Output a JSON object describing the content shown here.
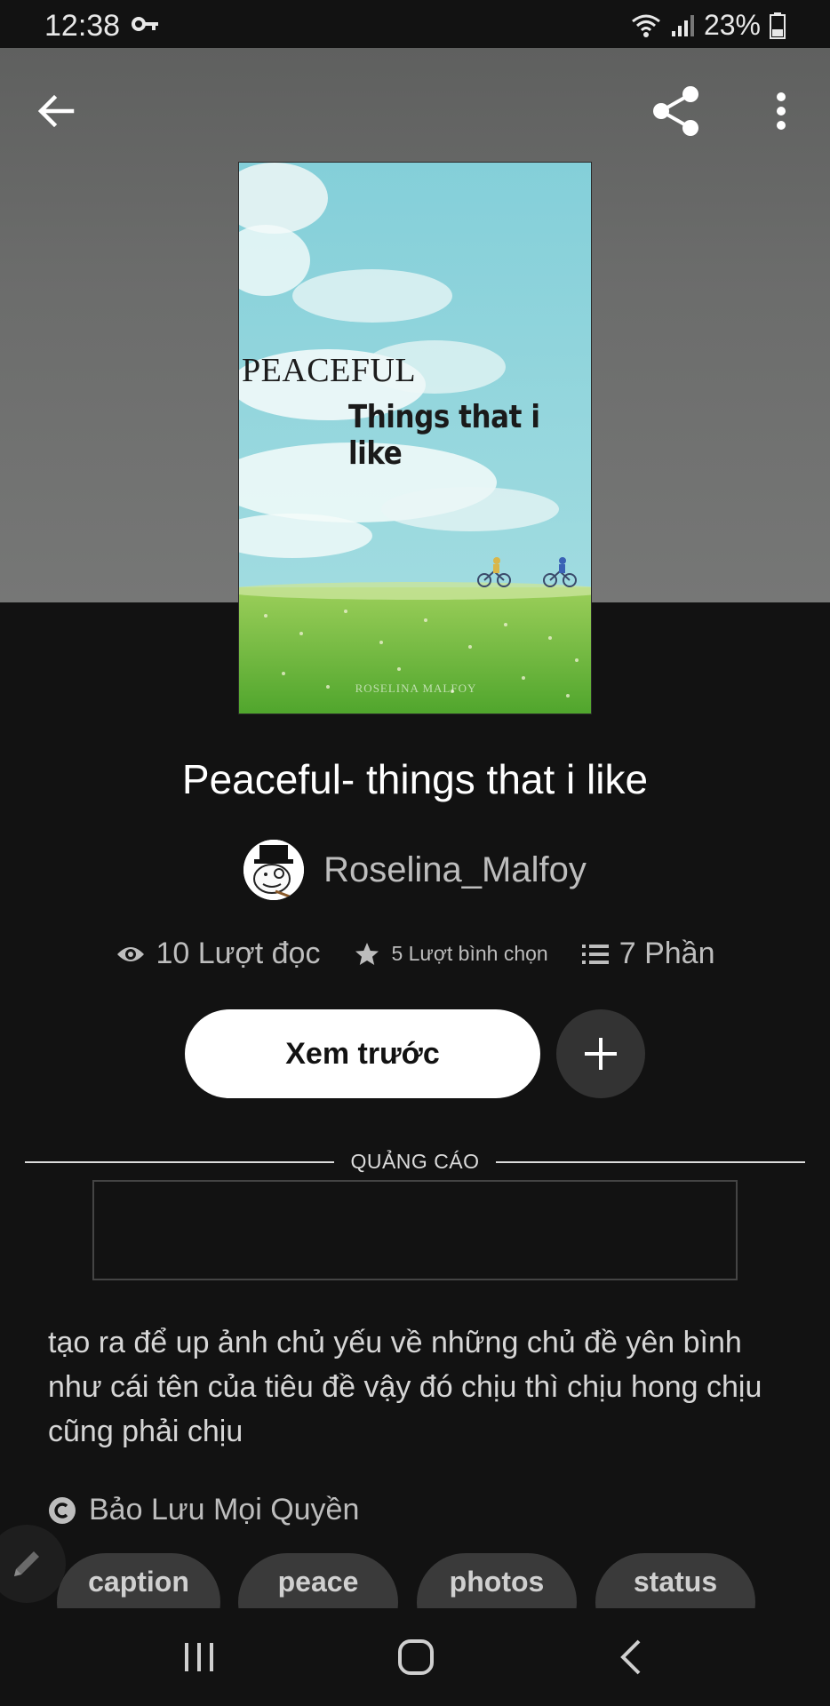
{
  "status_bar": {
    "time": "12:38",
    "battery": "23%"
  },
  "book": {
    "cover_title_line1": "PEACEFUL",
    "cover_title_line2": "Things that i like",
    "cover_author": "ROSELINA MALFOY",
    "title": "Peaceful- things that i like",
    "author": "Roselina_Malfoy"
  },
  "stats": {
    "reads": "10 Lượt đọc",
    "votes": "5 Lượt bình chọn",
    "parts": "7 Phần"
  },
  "actions": {
    "preview_label": "Xem trước"
  },
  "ad": {
    "label": "QUẢNG CÁO"
  },
  "description": "tạo ra để up ảnh chủ yếu về những chủ đề yên bình như cái tên của tiêu đề vậy  đó chịu thì chịu hong chịu cũng phải chịu",
  "copyright": "Bảo Lưu Mọi Quyền",
  "tags": [
    "caption",
    "peace",
    "photos",
    "status"
  ],
  "colors": {
    "background": "#121212",
    "button_light": "#ffffff",
    "tag_bg": "#3a3a3a"
  }
}
